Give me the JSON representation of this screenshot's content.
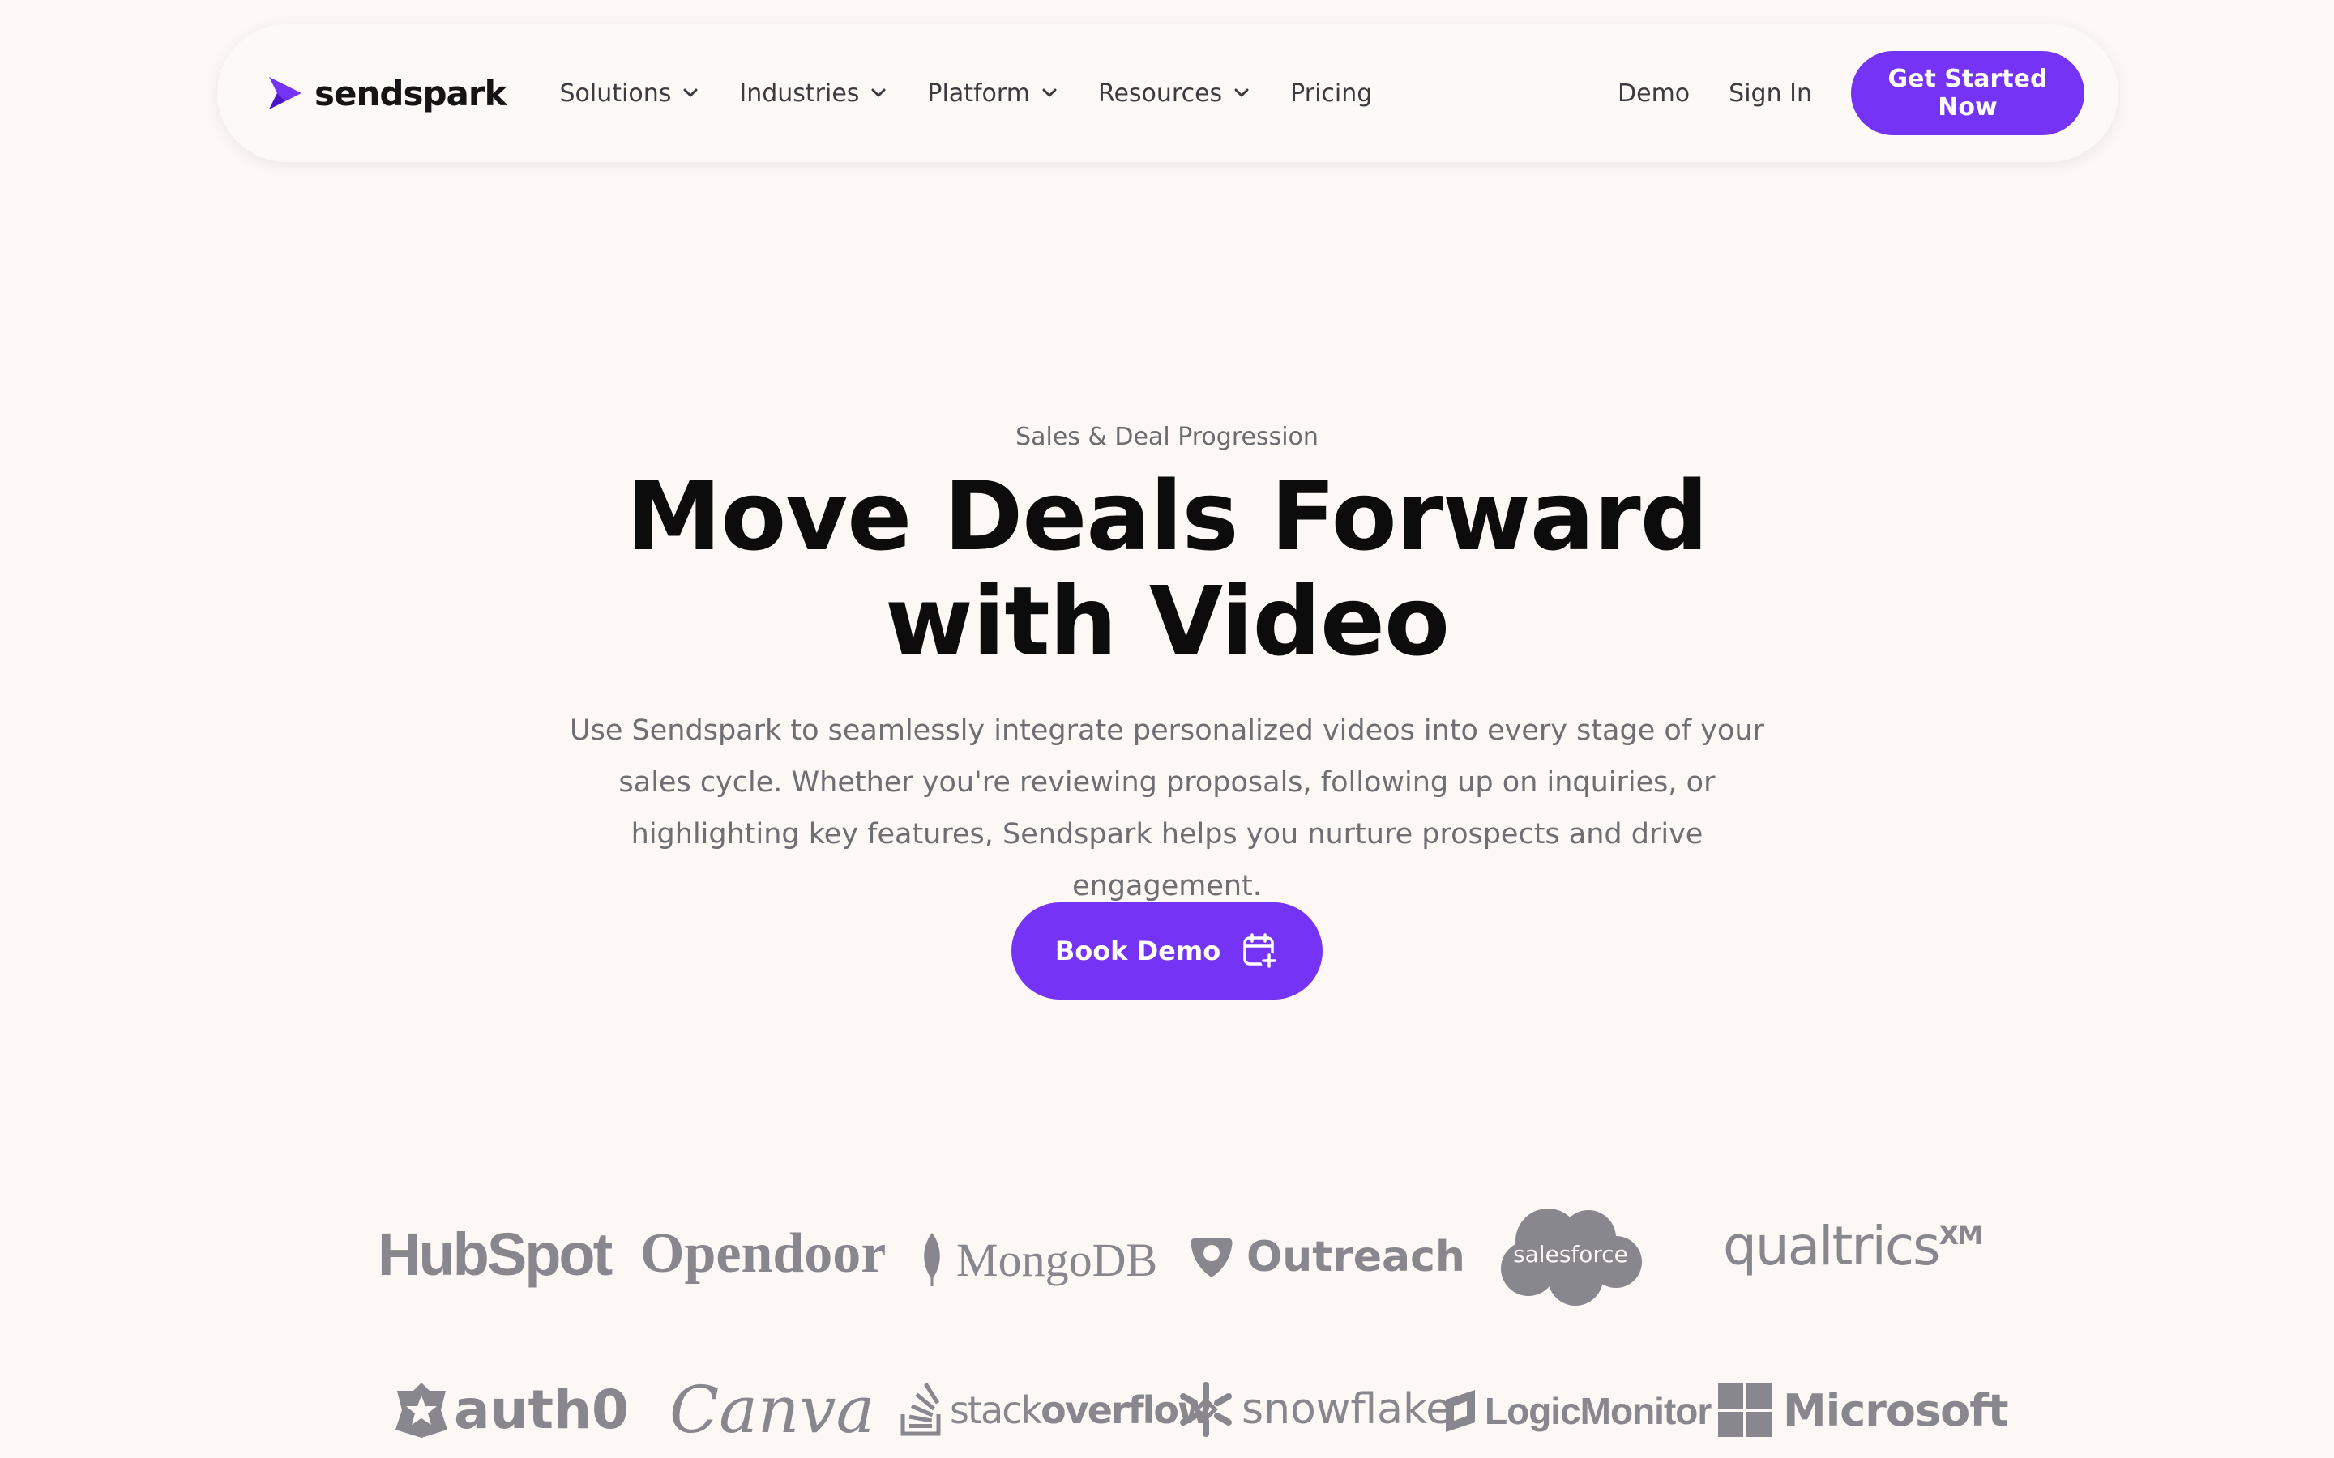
{
  "nav": {
    "brand": "sendspark",
    "menu": [
      {
        "label": "Solutions",
        "has_dropdown": true
      },
      {
        "label": "Industries",
        "has_dropdown": true
      },
      {
        "label": "Platform",
        "has_dropdown": true
      },
      {
        "label": "Resources",
        "has_dropdown": true
      },
      {
        "label": "Pricing",
        "has_dropdown": false
      }
    ],
    "demo": "Demo",
    "sign_in": "Sign In",
    "cta": "Get Started Now"
  },
  "hero": {
    "eyebrow": "Sales & Deal Progression",
    "headline": "Move Deals Forward with Video",
    "subcopy": "Use Sendspark to seamlessly integrate personalized videos into every stage of your sales cycle. Whether you're reviewing proposals, following up on inquiries, or highlighting key features, Sendspark helps you nurture prospects and drive engagement.",
    "button": "Book Demo"
  },
  "logos": {
    "row1": [
      "HubSpot",
      "Opendoor",
      "MongoDB",
      "Outreach",
      "salesforce",
      "qualtrics",
      "XM"
    ],
    "row2": [
      "auth0",
      "Canva",
      "stack",
      "overflow",
      "snowflake",
      "LogicMonitor",
      "Microsoft"
    ]
  },
  "colors": {
    "accent": "#7533f5",
    "background": "#fdf8f6",
    "logo_gray": "#88878e"
  }
}
